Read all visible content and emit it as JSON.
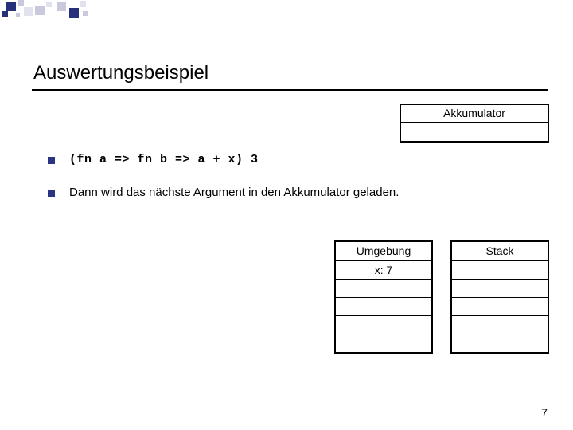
{
  "title": "Auswertungsbeispiel",
  "akkumulator": {
    "label": "Akkumulator",
    "value": ""
  },
  "bullets": [
    {
      "kind": "code",
      "text": "(fn a => fn b => a + x) 3"
    },
    {
      "kind": "prose",
      "text": "Dann wird das nächste Argument in den Akkumulator geladen."
    }
  ],
  "umgebung": {
    "label": "Umgebung",
    "rows": [
      "x: 7",
      "",
      "",
      "",
      ""
    ]
  },
  "stack": {
    "label": "Stack",
    "rows": [
      "",
      "",
      "",
      "",
      ""
    ]
  },
  "page_number": "7"
}
